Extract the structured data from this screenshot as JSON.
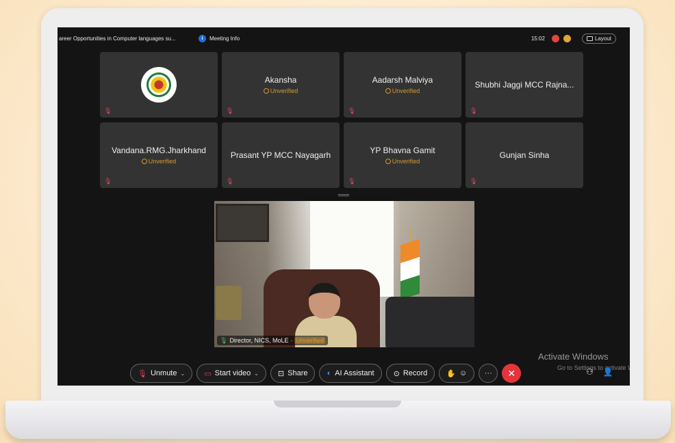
{
  "titlebar": {
    "meeting_title": "areer Opportunities in Computer languages su...",
    "meeting_info_label": "Meeting Info",
    "clock": "15:02",
    "layout_label": "Layout"
  },
  "participants": [
    {
      "name": "",
      "logo": true,
      "unverified": ""
    },
    {
      "name": "Akansha",
      "unverified": "Unverified"
    },
    {
      "name": "Aadarsh Malviya",
      "unverified": "Unverified"
    },
    {
      "name": "Shubhi Jaggi MCC Rajna...",
      "unverified": ""
    },
    {
      "name": "Vandana.RMG.Jharkhand",
      "unverified": "Unverified"
    },
    {
      "name": "Prasant YP MCC Nayagarh",
      "unverified": ""
    },
    {
      "name": "YP Bhavna Gamit",
      "unverified": "Unverified"
    },
    {
      "name": "Gunjan Sinha",
      "unverified": ""
    }
  ],
  "video": {
    "caption_name": "Director, NICS, MoLE",
    "caption_separator": "·",
    "caption_status": "Unverified"
  },
  "toolbar": {
    "unmute_label": "Unmute",
    "start_video_label": "Start video",
    "share_label": "Share",
    "ai_assistant_label": "AI Assistant",
    "record_label": "Record",
    "more_label": "···"
  },
  "watermark": {
    "title": "Activate Windows",
    "subtitle": "Go to Settings to activate W"
  },
  "colors": {
    "screen_bg": "#141414",
    "tile_bg": "#333333",
    "unverified": "#d99a2b",
    "end_call": "#e5343c",
    "info_blue": "#1e6fd9"
  },
  "icons": {
    "info": "meeting-info-icon",
    "layout": "layout-icon",
    "mute": "mic-muted-icon",
    "video": "video-off-icon",
    "share": "share-screen-icon",
    "ai": "ai-assistant-icon",
    "record": "record-icon",
    "hand": "raise-hand-icon",
    "reaction": "reaction-icon",
    "more": "more-icon",
    "end": "end-call-icon",
    "participants": "participants-icon"
  }
}
